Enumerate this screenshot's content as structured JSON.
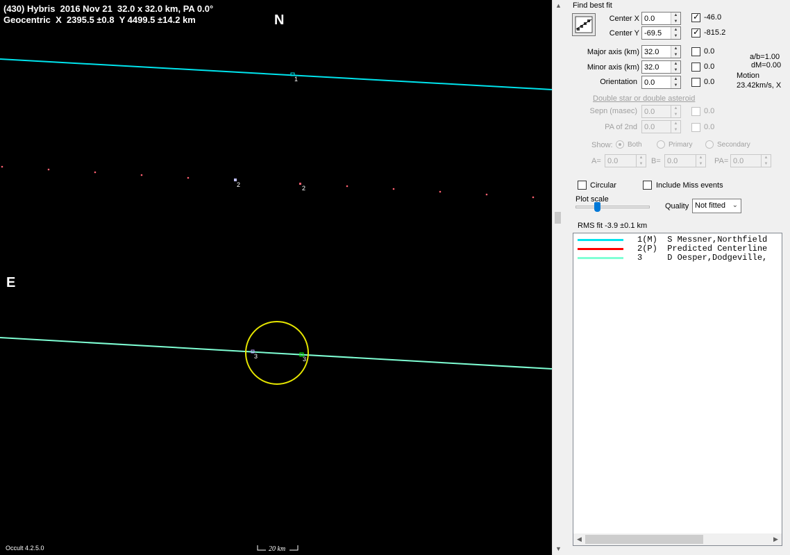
{
  "plot": {
    "header_line1": "(430) Hybris  2016 Nov 21  32.0 x 32.0 km, PA 0.0°",
    "header_line2": "Geocentric  X  2395.5 ±0.8  Y 4499.5 ±14.2 km",
    "north_label": "N",
    "east_label": "E",
    "version": "Occult 4.2.5.0",
    "scale_label": "20 km",
    "chord_labels": {
      "c1": "1",
      "c2a": "2",
      "c2b": "2",
      "c3a": "3",
      "c3b": "3"
    },
    "colors": {
      "chord1": "#00e5ee",
      "chord3": "#7fffd4",
      "ellipse": "#e6e600",
      "path_dots": "#ff6070"
    }
  },
  "panel": {
    "find_best_fit": "Find best fit",
    "center_x_label": "Center X",
    "center_x_value": "0.0",
    "center_x_check": "-46.0",
    "center_y_label": "Center Y",
    "center_y_value": "-69.5",
    "center_y_check": "-815.2",
    "major_axis_label": "Major axis (km)",
    "major_axis_value": "32.0",
    "major_axis_check": "0.0",
    "minor_axis_label": "Minor axis (km)",
    "minor_axis_value": "32.0",
    "minor_axis_check": "0.0",
    "orientation_label": "Orientation",
    "orientation_value": "0.0",
    "orientation_check": "0.0",
    "ab_ratio": "a/b=1.00",
    "dm": "dM=0.00",
    "motion_label": "Motion",
    "motion_value": "23.42km/s, X",
    "double_star_header": "Double star  or  double asteroid",
    "sepn_label": "Sepn (masec)",
    "sepn_value": "0.0",
    "sepn_check": "0.0",
    "pa2_label": "PA of 2nd",
    "pa2_value": "0.0",
    "pa2_check": "0.0",
    "show_label": "Show:",
    "show_both": "Both",
    "show_primary": "Primary",
    "show_secondary": "Secondary",
    "a_label": "A=",
    "a_value": "0.0",
    "b_label": "B=",
    "b_value": "0.0",
    "pa_label": "PA=",
    "pa_value": "0.0",
    "circular_label": "Circular",
    "include_miss_label": "Include Miss events",
    "plot_scale_label": "Plot scale",
    "quality_label": "Quality",
    "quality_value": "Not fitted",
    "rms_fit": "RMS fit  -3.9 ±0.1 km"
  },
  "legend": {
    "rows": [
      {
        "color": "#00e5ee",
        "text": "1(M)  S Messner,Northfield"
      },
      {
        "color": "#ff0000",
        "text": "2(P)  Predicted Centerline"
      },
      {
        "color": "#7fffd4",
        "text": "3     D Oesper,Dodgeville,"
      }
    ]
  }
}
